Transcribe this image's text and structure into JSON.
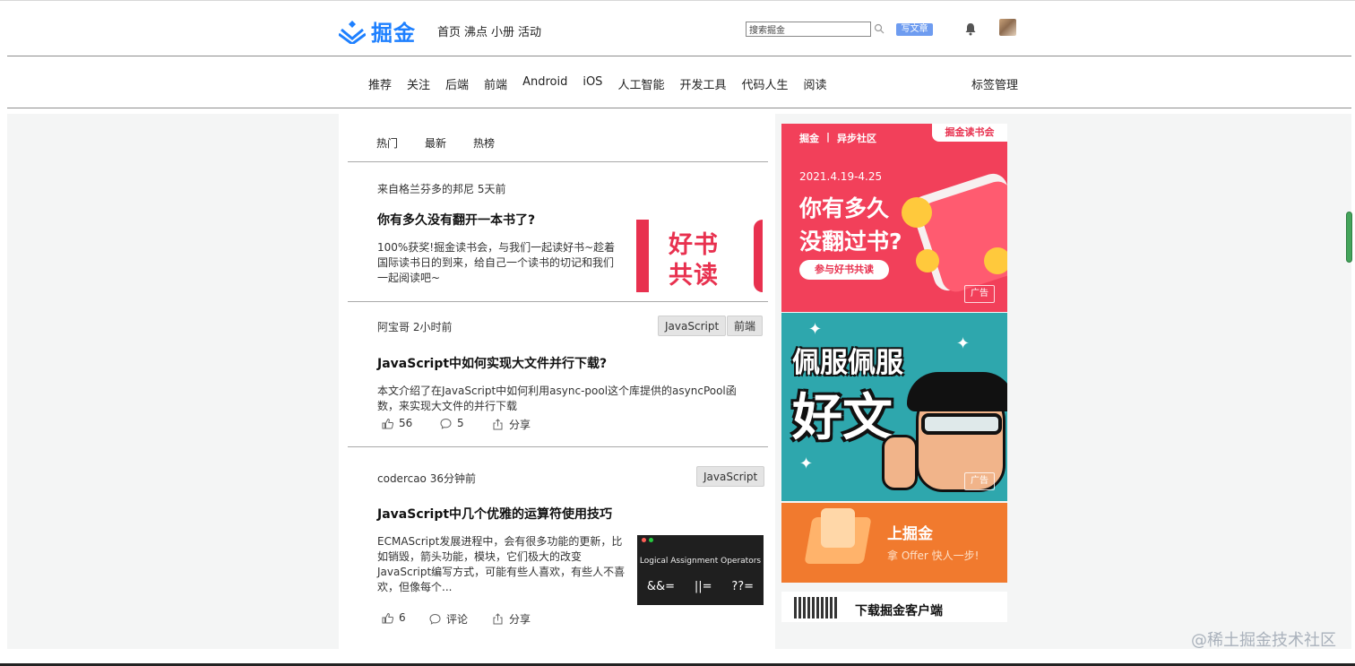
{
  "header": {
    "logo_text": "掘金",
    "nav": [
      "首页",
      "沸点",
      "小册",
      "活动"
    ],
    "search_placeholder": "搜索掘金",
    "write_button": "写文章"
  },
  "tagnav": {
    "tags": [
      "推荐",
      "关注",
      "后端",
      "前端",
      "Android",
      "iOS",
      "人工智能",
      "开发工具",
      "代码人生",
      "阅读"
    ],
    "manage": "标签管理"
  },
  "feed": {
    "tabs": [
      "热门",
      "最新",
      "热榜"
    ],
    "articles": [
      {
        "meta": "来自格兰芬多的邦尼 5天前",
        "title": "你有多久没有翻开一本书了?",
        "desc": [
          "100%获奖!掘金读书会，与我们一起读好书~趁着",
          "国际读书日的到来，给自己一个读书的切记和我们",
          "一起阅读吧~"
        ],
        "thumb_line1": "好书",
        "thumb_line2": "共读"
      },
      {
        "meta": "阿宝哥 2小时前",
        "tags": [
          "JavaScript",
          "前端"
        ],
        "title": "JavaScript中如何实现大文件并行下载?",
        "desc": [
          "本文介绍了在JavaScript中如何利用async-pool这个库提供的asyncPool函",
          "数，来实现大文件的并行下载"
        ],
        "likes": "56",
        "comments": "5",
        "share": "分享"
      },
      {
        "meta": "codercao 36分钟前",
        "tags": [
          "JavaScript"
        ],
        "title": "JavaScript中几个优雅的运算符使用技巧",
        "desc": [
          "ECMAScript发展进程中，会有很多功能的更新，比",
          "如销毁，箭头功能，模块，它们极大的改变",
          "JavaScript编写方式，可能有些人喜欢，有些人不喜",
          "欢，但像每个..."
        ],
        "likes": "6",
        "comments": "评论",
        "share": "分享",
        "thumb_caption": "Logical Assignment Operators",
        "thumb_ops": [
          "&&=",
          "||=",
          "??="
        ]
      }
    ]
  },
  "sidebar": {
    "ad1": {
      "brand_left": "掘金",
      "brand_right": "异步社区",
      "club": "掘金读书会",
      "date": "2021.4.19-4.25",
      "headline_1": "你有多久",
      "headline_2": "没翻过书?",
      "cta": "参与好书共读",
      "label": "广告"
    },
    "ad2": {
      "line1": "佩服佩服",
      "line2": "好文",
      "label": "广告"
    },
    "ad3": {
      "line1": "上掘金",
      "line2": "拿 Offer 快人一步!"
    },
    "download": "下载掘金客户端"
  },
  "watermark": "@稀土掘金技术社区",
  "colors": {
    "brand_blue": "#1e80ff",
    "ad_red": "#f2405a",
    "ad_teal": "#2ea7ad",
    "ad_orange": "#f17a2e"
  }
}
